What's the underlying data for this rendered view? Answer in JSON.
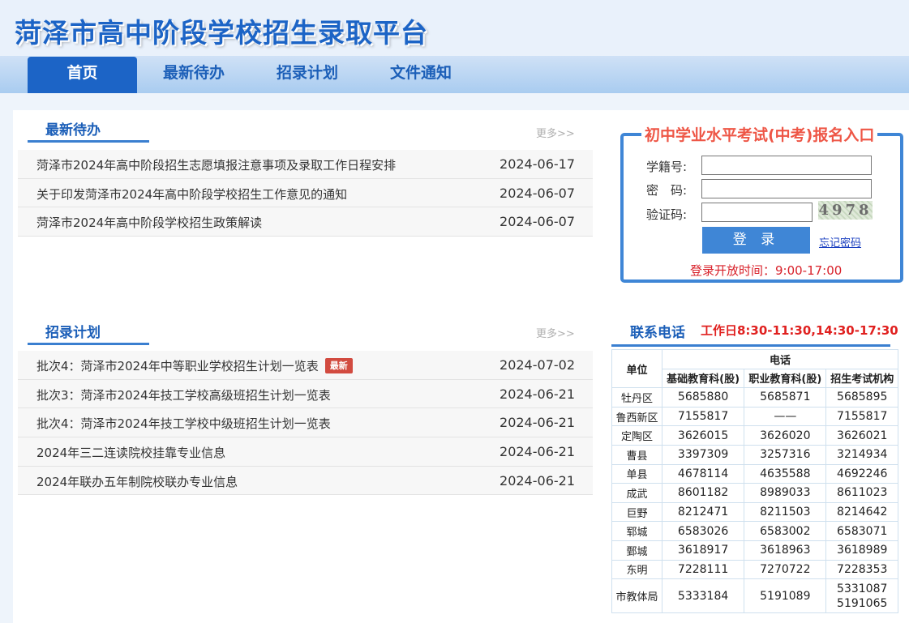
{
  "site": {
    "title": "菏泽市高中阶段学校招生录取平台"
  },
  "nav": [
    {
      "label": "首页"
    },
    {
      "label": "最新待办"
    },
    {
      "label": "招录计划"
    },
    {
      "label": "文件通知"
    }
  ],
  "todo": {
    "title": "最新待办",
    "more": "更多>>",
    "items": [
      {
        "text": "菏泽市2024年高中阶段招生志愿填报注意事项及录取工作日程安排",
        "date": "2024-06-17"
      },
      {
        "text": "关于印发菏泽市2024年高中阶段学校招生工作意见的通知",
        "date": "2024-06-07"
      },
      {
        "text": "菏泽市2024年高中阶段学校招生政策解读",
        "date": "2024-06-07"
      }
    ]
  },
  "plan": {
    "title": "招录计划",
    "more": "更多>>",
    "new_badge": "最新",
    "items": [
      {
        "text": "批次4：菏泽市2024年中等职业学校招生计划一览表",
        "date": "2024-07-02"
      },
      {
        "text": "批次3：菏泽市2024年技工学校高级班招生计划一览表",
        "date": "2024-06-21"
      },
      {
        "text": "批次4：菏泽市2024年技工学校中级班招生计划一览表",
        "date": "2024-06-21"
      },
      {
        "text": "2024年三二连读院校挂靠专业信息",
        "date": "2024-06-21"
      },
      {
        "text": "2024年联办五年制院校联办专业信息",
        "date": "2024-06-21"
      }
    ]
  },
  "login": {
    "title": "初中学业水平考试(中考)报名入口",
    "student_id_label": "学籍号:",
    "password_label": "密　码:",
    "captcha_label": "验证码:",
    "captcha_value": "4978",
    "login_button": "登 录",
    "forgot_link": "忘记密码",
    "open_time": "登录开放时间：9:00-17:00"
  },
  "contact": {
    "title": "联系电话",
    "hours": "工作日8:30-11:30,14:30-17:30",
    "headers": {
      "unit": "单位",
      "phone": "电话",
      "cols": [
        "基础教育科(股)",
        "职业教育科(股)",
        "招生考试机构"
      ]
    },
    "rows": [
      {
        "unit": "牡丹区",
        "c1": "5685880",
        "c2": "5685871",
        "c3": "5685895"
      },
      {
        "unit": "鲁西新区",
        "c1": "7155817",
        "c2": "——",
        "c3": "7155817"
      },
      {
        "unit": "定陶区",
        "c1": "3626015",
        "c2": "3626020",
        "c3": "3626021"
      },
      {
        "unit": "曹县",
        "c1": "3397309",
        "c2": "3257316",
        "c3": "3214934"
      },
      {
        "unit": "单县",
        "c1": "4678114",
        "c2": "4635588",
        "c3": "4692246"
      },
      {
        "unit": "成武",
        "c1": "8601182",
        "c2": "8989033",
        "c3": "8611023"
      },
      {
        "unit": "巨野",
        "c1": "8212471",
        "c2": "8211503",
        "c3": "8214642"
      },
      {
        "unit": "郓城",
        "c1": "6583026",
        "c2": "6583002",
        "c3": "6583071"
      },
      {
        "unit": "鄄城",
        "c1": "3618917",
        "c2": "3618963",
        "c3": "3618989"
      },
      {
        "unit": "东明",
        "c1": "7228111",
        "c2": "7270722",
        "c3": "7228353"
      },
      {
        "unit": "市教体局",
        "c1": "5333184",
        "c2": "5191089",
        "c3": "5331087",
        "c3b": "5191065"
      }
    ]
  }
}
